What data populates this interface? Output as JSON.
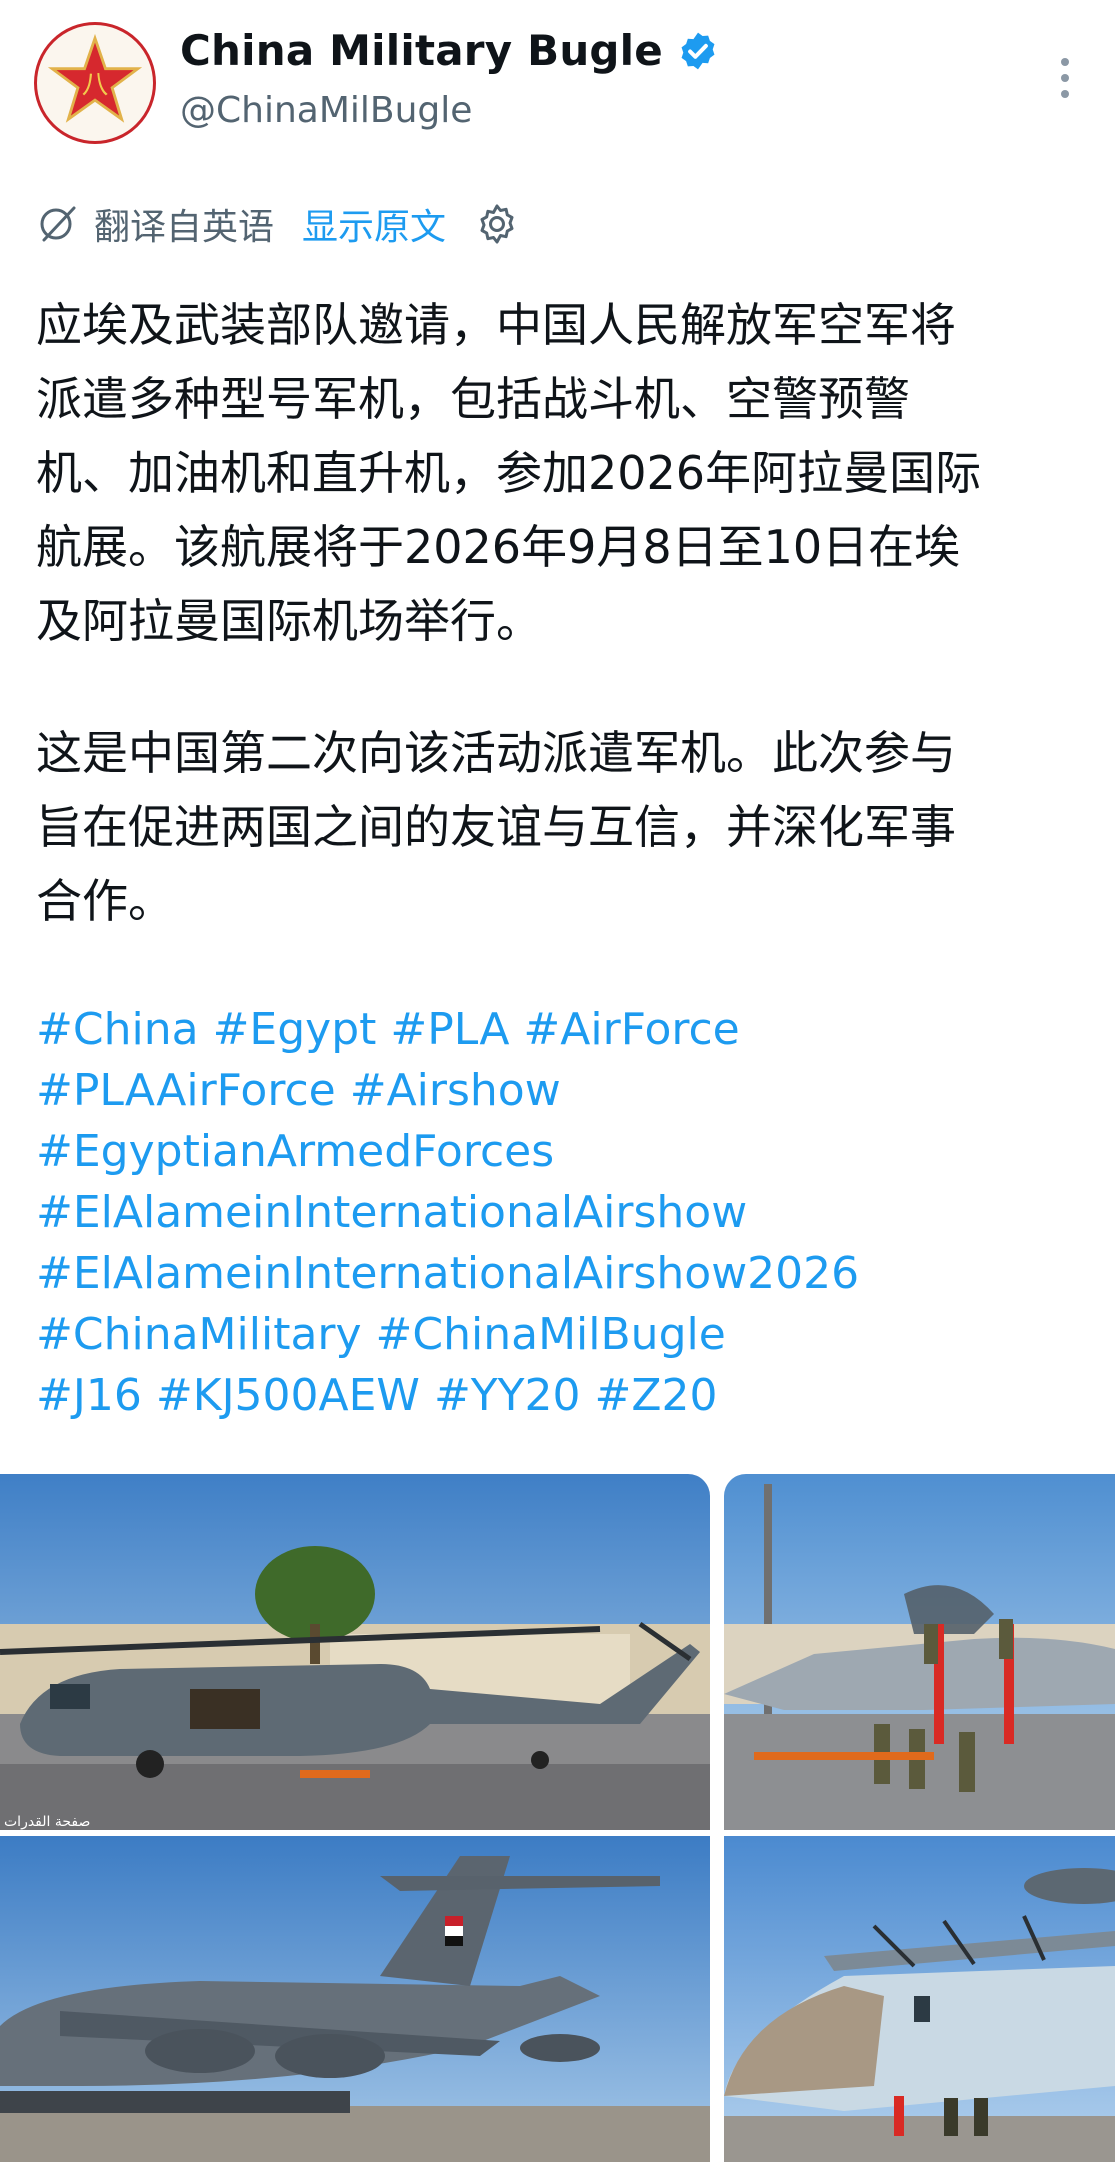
{
  "author": {
    "display_name": "China Military Bugle",
    "handle": "@ChinaMilBugle",
    "verified": true,
    "avatar_glyph": "八"
  },
  "translation": {
    "label": "翻译自英语",
    "show_original": "显示原文"
  },
  "post": {
    "paragraph1": [
      "应埃及武装部队邀请，中国人民解放军空军将",
      "派遣多种型号军机，包括战斗机、空警预警",
      "机、加油机和直升机，参加2026年阿拉曼国际",
      "航展。该航展将于2026年9月8日至10日在埃",
      "及阿拉曼国际机场举行。"
    ],
    "paragraph2": [
      "这是中国第二次向该活动派遣军机。此次参与",
      "旨在促进两国之间的友谊与互信，并深化军事",
      "合作。"
    ]
  },
  "hashtags": [
    [
      "#China",
      "#Egypt",
      "#PLA",
      "#AirForce"
    ],
    [
      "#PLAAirForce",
      "#Airshow"
    ],
    [
      "#EgyptianArmedForces"
    ],
    [
      "#ElAlameinInternationalAirshow"
    ],
    [
      "#ElAlameinInternationalAirshow2026"
    ],
    [
      "#ChinaMilitary",
      "#ChinaMilBugle"
    ],
    [
      "#J16",
      "#KJ500AEW",
      "#YY20",
      "#Z20"
    ]
  ],
  "media": {
    "watermark": "صفحة القدرات"
  },
  "colors": {
    "accent": "#1d9bf0",
    "text": "#0f1419",
    "muted": "#536471",
    "avatar_red": "#c9252b"
  },
  "icons": {
    "verified": "verified-badge-icon",
    "translate": "translate-icon",
    "settings": "gear-icon",
    "more": "more-options-icon"
  }
}
